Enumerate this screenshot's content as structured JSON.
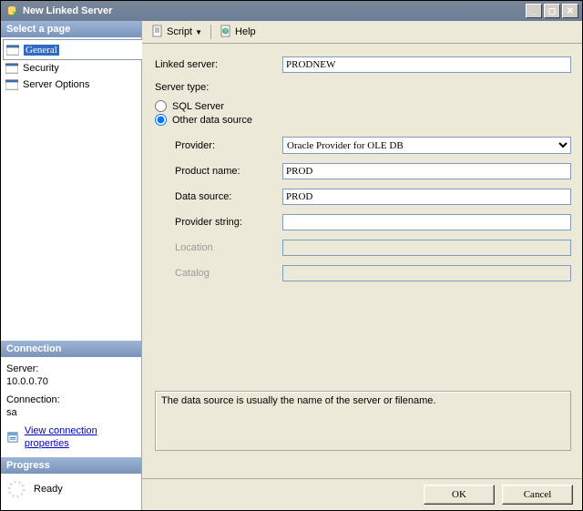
{
  "window": {
    "title": "New Linked Server"
  },
  "toolbar": {
    "script_label": "Script",
    "help_label": "Help"
  },
  "sidebar": {
    "heading_pages": "Select a page",
    "items": [
      {
        "label": "General"
      },
      {
        "label": "Security"
      },
      {
        "label": "Server Options"
      }
    ],
    "heading_connection": "Connection",
    "server_label": "Server:",
    "server_value": "10.0.0.70",
    "conn_label": "Connection:",
    "conn_value": "sa",
    "view_props": "View connection properties",
    "heading_progress": "Progress",
    "progress_value": "Ready"
  },
  "form": {
    "linked_server_label": "Linked server:",
    "linked_server_value": "PRODNEW",
    "server_type_label": "Server type:",
    "radio_sql": "SQL Server",
    "radio_other": "Other data source",
    "fields": {
      "provider_label": "Provider:",
      "provider_value": "Oracle Provider for OLE DB",
      "product_label": "Product name:",
      "product_value": "PROD",
      "datasource_label": "Data source:",
      "datasource_value": "PROD",
      "provstr_label": "Provider string:",
      "provstr_value": "",
      "location_label": "Location",
      "location_value": "",
      "catalog_label": "Catalog",
      "catalog_value": ""
    },
    "hint": "The data source is usually the name of the server or filename."
  },
  "buttons": {
    "ok": "OK",
    "cancel": "Cancel"
  }
}
